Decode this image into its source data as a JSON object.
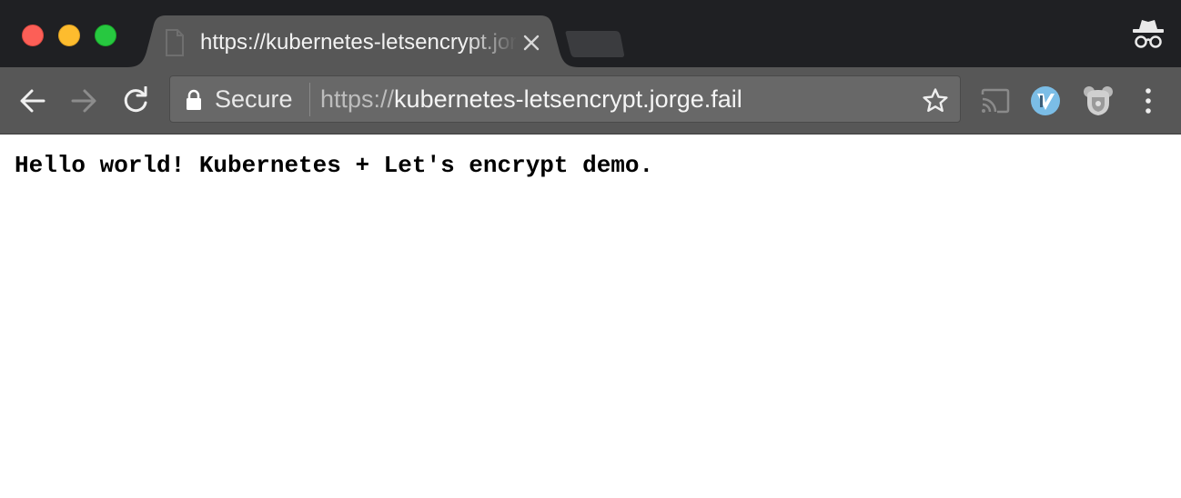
{
  "tab": {
    "title": "https://kubernetes-letsencrypt.jorge.fail"
  },
  "omnibox": {
    "security_label": "Secure",
    "url_scheme": "https://",
    "url_host": "kubernetes-letsencrypt.jorge.fail"
  },
  "page": {
    "text": "Hello world! Kubernetes + Let's encrypt demo."
  },
  "colors": {
    "titlebar": "#1f2023",
    "active_tab": "#575757",
    "toolbar": "#575757",
    "omnibox": "#686868",
    "close": "#fc5f57",
    "minimize": "#fdbc2e",
    "maximize": "#27c840",
    "extension_accent": "#7bbde6"
  },
  "icons": {
    "toolbar": [
      "back-arrow-icon",
      "forward-arrow-icon",
      "reload-icon",
      "lock-icon",
      "star-icon",
      "cast-icon",
      "vimium-extension-icon",
      "bear-extension-icon",
      "menu-kebab-icon"
    ],
    "titlebar": [
      "page-icon",
      "close-tab-icon",
      "incognito-icon"
    ]
  }
}
